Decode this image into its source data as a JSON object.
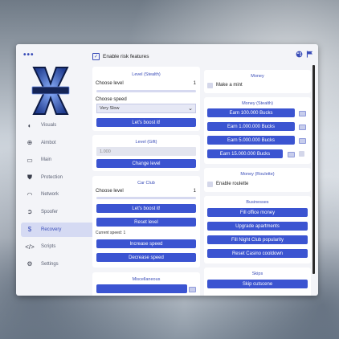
{
  "app": {
    "enable_risk_label": "Enable risk features",
    "dots": "•••"
  },
  "sidebar": {
    "items": [
      {
        "label": "Visuals",
        "icon": "half-circle-icon"
      },
      {
        "label": "Aimbot",
        "icon": "crosshair-icon"
      },
      {
        "label": "Main",
        "icon": "window-icon"
      },
      {
        "label": "Protection",
        "icon": "shield-icon"
      },
      {
        "label": "Network",
        "icon": "wifi-icon"
      },
      {
        "label": "Spoofer",
        "icon": "spoofer-icon"
      },
      {
        "label": "Recovery",
        "icon": "dollar-icon",
        "active": true
      },
      {
        "label": "Scripts",
        "icon": "code-icon"
      },
      {
        "label": "Settings",
        "icon": "gears-icon"
      }
    ]
  },
  "level_stealth": {
    "title": "Level (Stealth)",
    "choose_label": "Choose level",
    "level_value": "1",
    "speed_label": "Choose speed",
    "speed_value": "Very Slow",
    "boost_button": "Let's boost it!"
  },
  "level_gift": {
    "title": "Level (Gift)",
    "input_placeholder": "1.000",
    "change_button": "Change level"
  },
  "car_club": {
    "title": "Car Club",
    "choose_label": "Choose level",
    "level_value": "1",
    "boost_button": "Let's boost it!",
    "reset_button": "Reset level",
    "speed_text": "Current speed: 1",
    "increase_button": "Increase speed",
    "decrease_button": "Decrease speed"
  },
  "misc": {
    "title": "Miscellaneous"
  },
  "money": {
    "title": "Money",
    "mint_label": "Make a mint"
  },
  "money_stealth": {
    "title": "Money (Stealth)",
    "buttons": [
      "Earn 100.000 Bucks",
      "Earn 1.000.000 Bucks",
      "Earn 5.000.000 Bucks",
      "Earn 15.000.000 Bucks"
    ]
  },
  "money_roulette": {
    "title": "Money (Roulette)",
    "roulette_label": "Enable roulette"
  },
  "businesses": {
    "title": "Businesses",
    "buttons": [
      "Fill office money",
      "Upgrade apartments",
      "Fill Night Club popularity",
      "Reset Casino cooldown"
    ]
  },
  "skips": {
    "title": "Skips",
    "skip_button": "Skip cutscene"
  },
  "colors": {
    "accent": "#3b54d1",
    "active_bg": "#d5daf3"
  }
}
